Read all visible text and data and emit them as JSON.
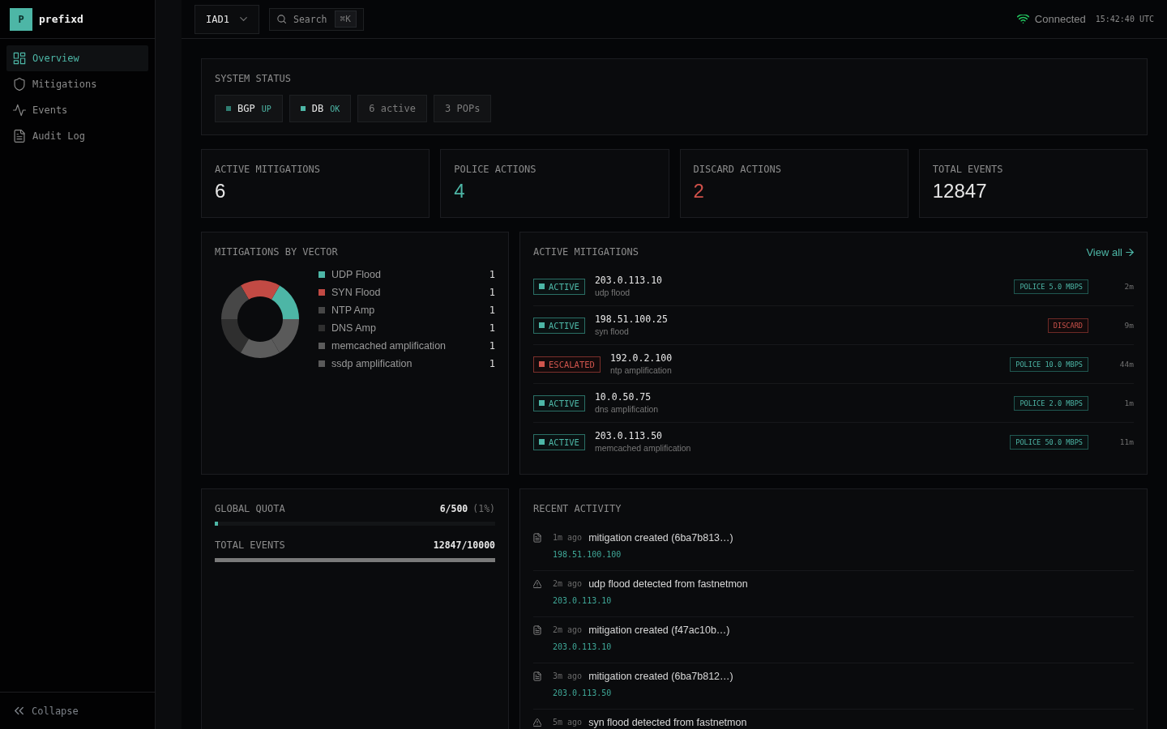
{
  "sidebar": {
    "logo": {
      "mark": "P",
      "name": "prefixd"
    },
    "nav": [
      {
        "label": "Overview",
        "selected": true
      },
      {
        "label": "Mitigations",
        "selected": false
      },
      {
        "label": "Events",
        "selected": false
      },
      {
        "label": "Audit Log",
        "selected": false
      }
    ],
    "collapse": "Collapse"
  },
  "header": {
    "region": "IAD1",
    "search": {
      "label": "Search",
      "shortcut": "⌘K"
    },
    "connection": {
      "label": "Connected",
      "connected": true
    },
    "clock": "15:42:40 UTC"
  },
  "system_status": {
    "title": "SYSTEM STATUS",
    "items": [
      {
        "kind": "service",
        "name": "BGP",
        "status": "UP",
        "color": "#2f7d71"
      },
      {
        "kind": "service",
        "name": "DB",
        "status": "OK",
        "color": "#4db6a6"
      },
      {
        "kind": "count",
        "label": "6 active"
      },
      {
        "kind": "count",
        "label": "3 POPs"
      }
    ]
  },
  "stats": [
    {
      "label": "ACTIVE MITIGATIONS",
      "value": "6",
      "color": "#e6e6e6"
    },
    {
      "label": "POLICE ACTIONS",
      "value": "4",
      "color": "#4db6a6"
    },
    {
      "label": "DISCARD ACTIONS",
      "value": "2",
      "color": "#d0514a"
    },
    {
      "label": "TOTAL EVENTS",
      "value": "12847",
      "color": "#e6e6e6"
    }
  ],
  "vector_card": {
    "title": "MITIGATIONS BY VECTOR",
    "chart_data": {
      "type": "donut",
      "categories": [
        "UDP Flood",
        "SYN Flood",
        "NTP Amp",
        "DNS Amp",
        "memcached amplification",
        "ssdp amplification"
      ],
      "values": [
        1,
        1,
        1,
        1,
        1,
        1
      ],
      "value_labels": [
        "1",
        "1",
        "1",
        "1",
        "1",
        "1"
      ],
      "colors": [
        "#4db6a6",
        "#c24a44",
        "#474747",
        "#2f2f2f",
        "#5c5c5c",
        "#5a5a5a"
      ],
      "legend": "right"
    }
  },
  "mitigations_card": {
    "title": "ACTIVE MITIGATIONS",
    "link": "View all",
    "rows": [
      {
        "status": {
          "kind": "active",
          "label": "ACTIVE"
        },
        "ip": "203.0.113.10",
        "vector": "udp flood",
        "action": {
          "kind": "police",
          "label": "POLICE 5.0 MBPS"
        },
        "age": "2m"
      },
      {
        "status": {
          "kind": "active",
          "label": "ACTIVE"
        },
        "ip": "198.51.100.25",
        "vector": "syn flood",
        "action": {
          "kind": "discard",
          "label": "DISCARD"
        },
        "age": "9m"
      },
      {
        "status": {
          "kind": "escalated",
          "label": "ESCALATED"
        },
        "ip": "192.0.2.100",
        "vector": "ntp amplification",
        "action": {
          "kind": "police",
          "label": "POLICE 10.0 MBPS"
        },
        "age": "44m"
      },
      {
        "status": {
          "kind": "active",
          "label": "ACTIVE"
        },
        "ip": "10.0.50.75",
        "vector": "dns amplification",
        "action": {
          "kind": "police",
          "label": "POLICE 2.0 MBPS"
        },
        "age": "1m"
      },
      {
        "status": {
          "kind": "active",
          "label": "ACTIVE"
        },
        "ip": "203.0.113.50",
        "vector": "memcached amplification",
        "action": {
          "kind": "police",
          "label": "POLICE 50.0 MBPS"
        },
        "age": "11m"
      }
    ]
  },
  "quota_card": {
    "meters": [
      {
        "label": "GLOBAL QUOTA",
        "value": "6/500",
        "note": "(1%)",
        "level": 0.012,
        "color": "#4db6a6"
      },
      {
        "label": "TOTAL EVENTS",
        "value": "12847/10000",
        "level": 1,
        "color": "#7a7a7a"
      }
    ]
  },
  "activity_card": {
    "title": "RECENT ACTIVITY",
    "items": [
      {
        "kind": "mitigation",
        "age": "1m ago",
        "message": "mitigation created (6ba7b813…)",
        "ip": "198.51.100.100"
      },
      {
        "kind": "detection",
        "age": "2m ago",
        "message": "udp flood detected from fastnetmon",
        "ip": "203.0.113.10"
      },
      {
        "kind": "mitigation",
        "age": "2m ago",
        "message": "mitigation created (f47ac10b…)",
        "ip": "203.0.113.10"
      },
      {
        "kind": "mitigation",
        "age": "3m ago",
        "message": "mitigation created (6ba7b812…)",
        "ip": "203.0.113.50"
      },
      {
        "kind": "detection",
        "age": "5m ago",
        "message": "syn flood detected from fastnetmon"
      }
    ]
  }
}
